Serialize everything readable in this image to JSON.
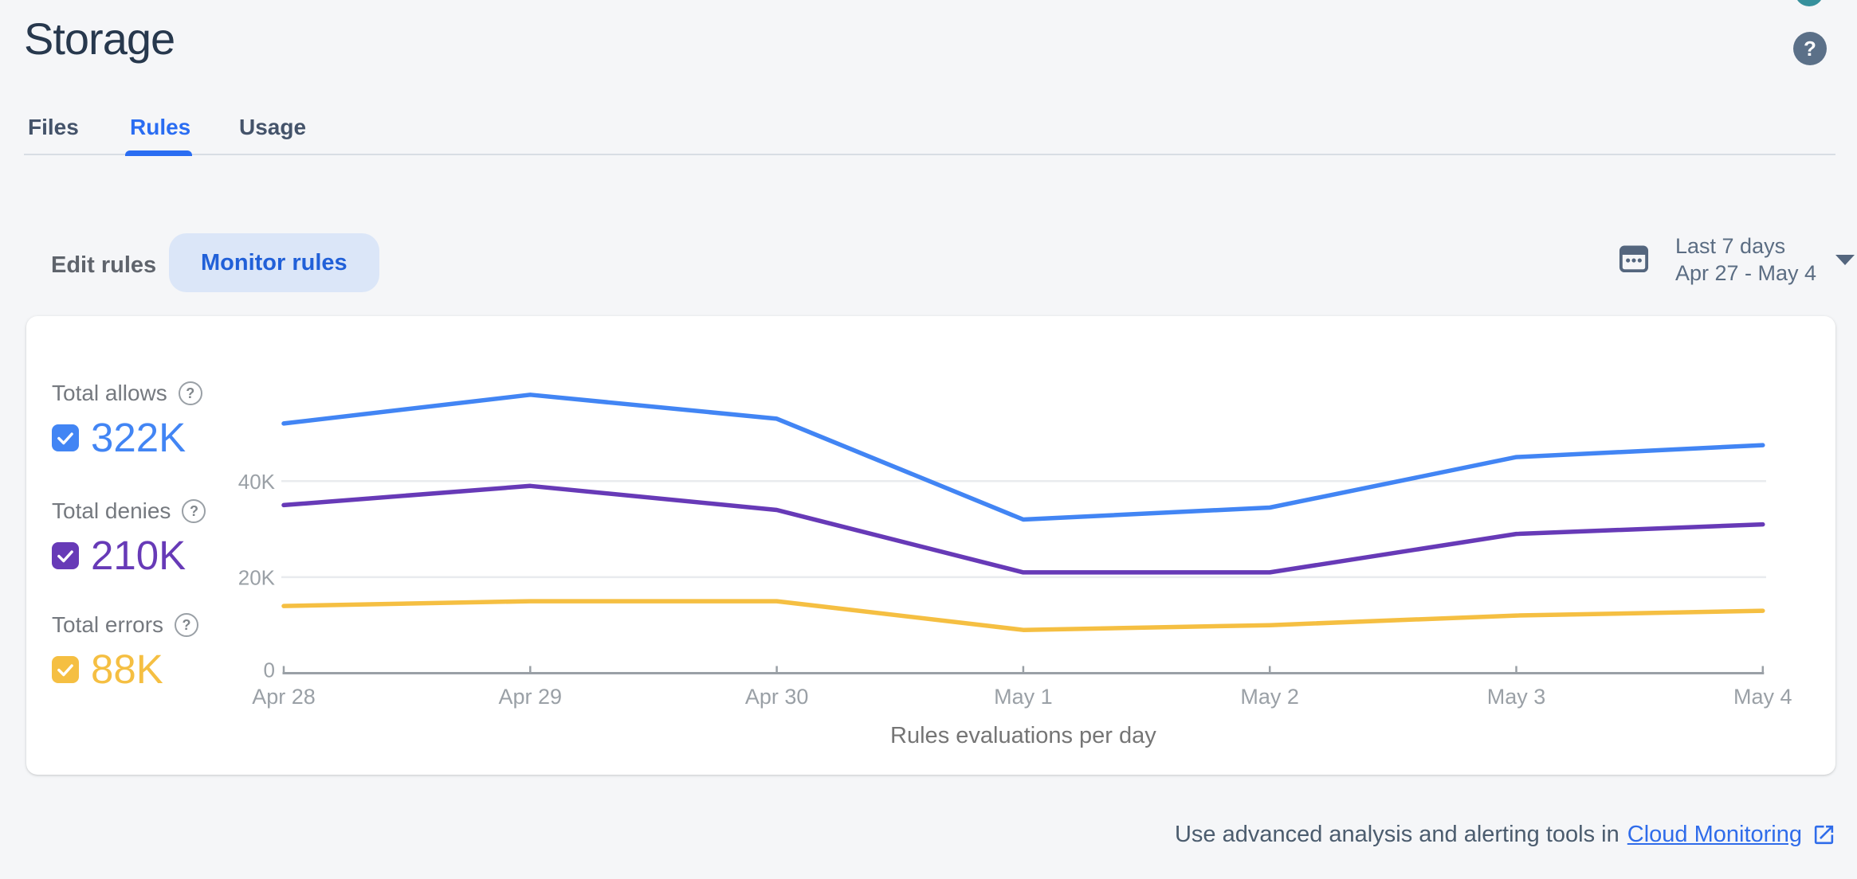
{
  "page": {
    "background": "#f5f6f8"
  },
  "icons": {
    "question": "?"
  },
  "header": {
    "title": "Storage"
  },
  "tabs": [
    {
      "label": "Files",
      "active": false
    },
    {
      "label": "Rules",
      "active": true
    },
    {
      "label": "Usage",
      "active": false
    }
  ],
  "toolbar": {
    "edit_rules": "Edit rules",
    "monitor_rules": "Monitor rules"
  },
  "date_range": {
    "label": "Last 7 days",
    "range": "Apr 27 - May 4"
  },
  "legend": [
    {
      "label": "Total allows",
      "value": "322K",
      "color": "#4285f4",
      "checked": true
    },
    {
      "label": "Total denies",
      "value": "210K",
      "color": "#673ab7",
      "checked": true
    },
    {
      "label": "Total errors",
      "value": "88K",
      "color": "#f5bf42",
      "checked": true
    }
  ],
  "chart_data": {
    "type": "line",
    "x_categories": [
      "Apr 28",
      "Apr 29",
      "Apr 30",
      "May 1",
      "May 2",
      "May 3",
      "May 4"
    ],
    "series": [
      {
        "name": "Total allows",
        "total": "322K",
        "color": "#4285f4",
        "values_k": [
          52,
          58,
          53,
          32,
          34.5,
          45,
          47.5
        ]
      },
      {
        "name": "Total denies",
        "total": "210K",
        "color": "#673ab7",
        "values_k": [
          35,
          39,
          34,
          21,
          21,
          29,
          31
        ]
      },
      {
        "name": "Total errors",
        "total": "88K",
        "color": "#f5bf42",
        "values_k": [
          14,
          15,
          15,
          9,
          10,
          12,
          13
        ]
      }
    ],
    "yticks": [
      {
        "v": 0,
        "label": "0"
      },
      {
        "v": 20,
        "label": "20K"
      },
      {
        "v": 40,
        "label": "40K"
      }
    ],
    "ylim_k": [
      0,
      65
    ],
    "xlabel": "Rules evaluations per day",
    "grid": "horizontal-light",
    "legend_position": "left"
  },
  "footer": {
    "text": "Use advanced analysis and alerting tools in",
    "link_label": "Cloud Monitoring"
  }
}
